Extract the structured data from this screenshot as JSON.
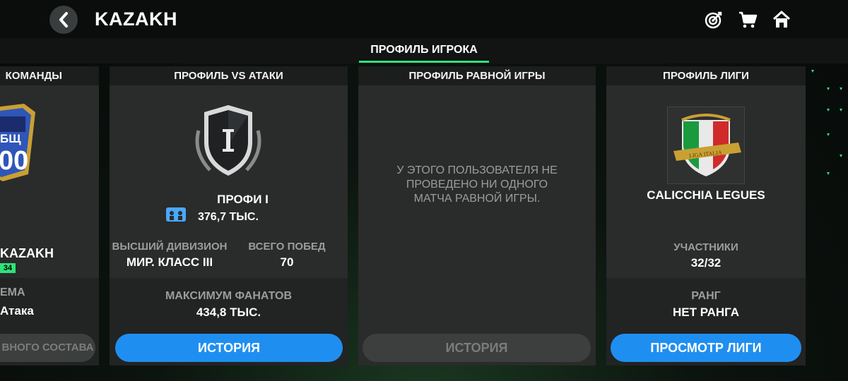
{
  "header": {
    "title": "KAZAKH"
  },
  "tabs": {
    "active_label": "ПРОФИЛЬ ИГРОКА"
  },
  "team_panel": {
    "heading": "КОМАНДЫ",
    "badge_text_top": "БЩ",
    "badge_text_num": "00",
    "team_name": "KAZAKH",
    "level": "34",
    "scheme_label": "ЕМА",
    "scheme_value": "Атака",
    "button_label": "ВНОГО СОСТАВА"
  },
  "vs_attack_panel": {
    "heading": "ПРОФИЛЬ VS АТАКИ",
    "rank_numeral": "I",
    "rank_name": "ПРОФИ I",
    "fans": "376,7 ТЫС.",
    "top_division_label": "ВЫСШИЙ ДИВИЗИОН",
    "top_division_value": "МИР. КЛАСС III",
    "total_wins_label": "ВСЕГО ПОБЕД",
    "total_wins_value": "70",
    "max_fans_label": "МАКСИМУМ ФАНАТОВ",
    "max_fans_value": "434,8 ТЫС.",
    "button_label": "ИСТОРИЯ"
  },
  "equal_game_panel": {
    "heading": "ПРОФИЛЬ РАВНОЙ ИГРЫ",
    "message": "У ЭТОГО ПОЛЬЗОВАТЕЛЯ НЕ ПРОВЕДЕНО НИ ОДНОГО МАТЧА РАВНОЙ ИГРЫ.",
    "button_label": "ИСТОРИЯ"
  },
  "league_panel": {
    "heading": "ПРОФИЛЬ ЛИГИ",
    "league_logo_text": "LIGA ITALIA",
    "league_name": "CALICCHIA LEGUES",
    "members_label": "УЧАСТНИКИ",
    "members_value": "32/32",
    "rank_label": "РАНГ",
    "rank_value": "НЕТ РАНГА",
    "button_label": "ПРОСМОТР ЛИГИ"
  },
  "colors": {
    "accent_green": "#2ee37a",
    "button_blue": "#1e8ff0",
    "level_badge": "#2ee37a",
    "panel_bg": "#2a2b2b"
  }
}
